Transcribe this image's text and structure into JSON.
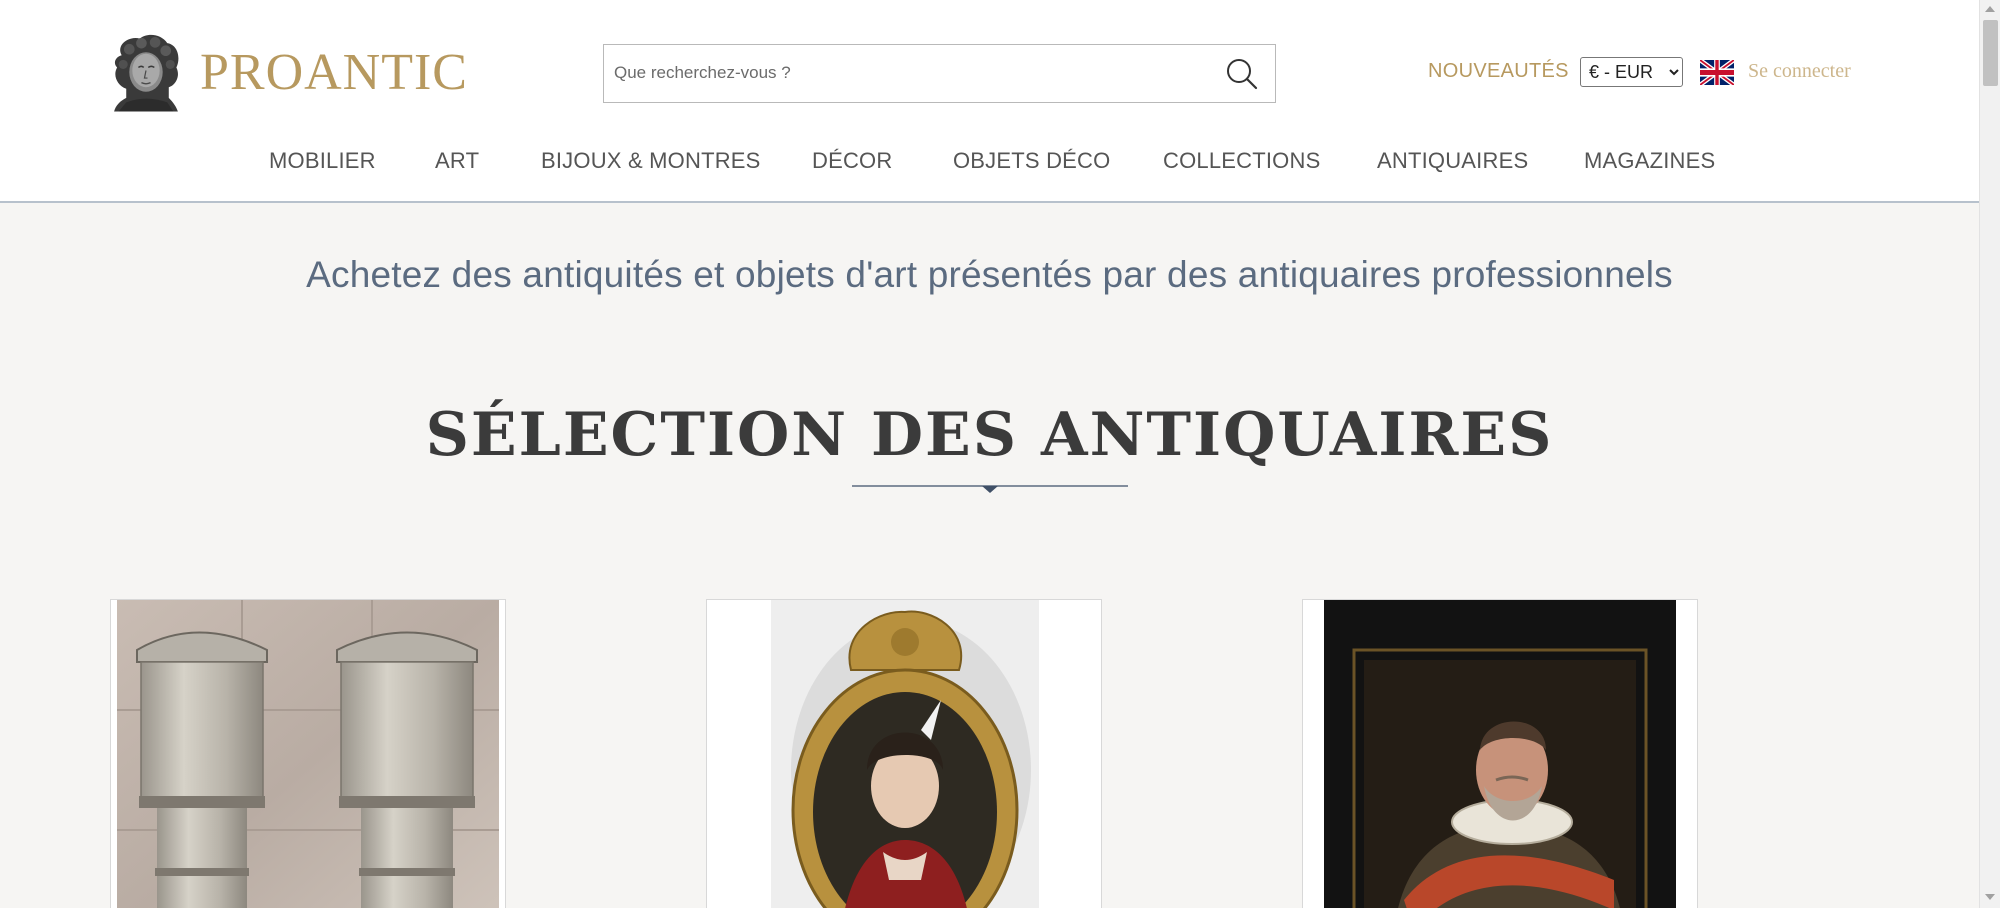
{
  "brand": {
    "name": "PROANTIC",
    "logo_icon": "bust-icon"
  },
  "search": {
    "placeholder": "Que recherchez-vous ?",
    "icon": "search-icon"
  },
  "header": {
    "nouveautes_label": "NOUVEAUTÉS",
    "currency": {
      "selected": "€ - EUR",
      "options": [
        "€ - EUR"
      ]
    },
    "language_flag": "uk-flag-icon",
    "login_label": "Se connecter"
  },
  "nav": {
    "items": [
      {
        "label": "MOBILIER"
      },
      {
        "label": "ART"
      },
      {
        "label": "BIJOUX & MONTRES"
      },
      {
        "label": "DÉCOR"
      },
      {
        "label": "OBJETS DÉCO"
      },
      {
        "label": "COLLECTIONS"
      },
      {
        "label": "ANTIQUAIRES"
      },
      {
        "label": "MAGAZINES"
      }
    ]
  },
  "tagline": "Achetez des antiquités et objets d'art présentés par des antiquaires professionnels",
  "section": {
    "title": "SÉLECTION DES ANTIQUAIRES"
  },
  "products": [
    {
      "image": "art-deco-glass-wall-sconces-photo"
    },
    {
      "image": "oval-gilt-framed-portrait-of-lady-photo"
    },
    {
      "image": "framed-portrait-of-bearded-man-in-ruff-photo"
    }
  ],
  "colors": {
    "brand_gold": "#b7995f",
    "tagline_blue": "#5b6b80",
    "background": "#f6f5f3"
  }
}
